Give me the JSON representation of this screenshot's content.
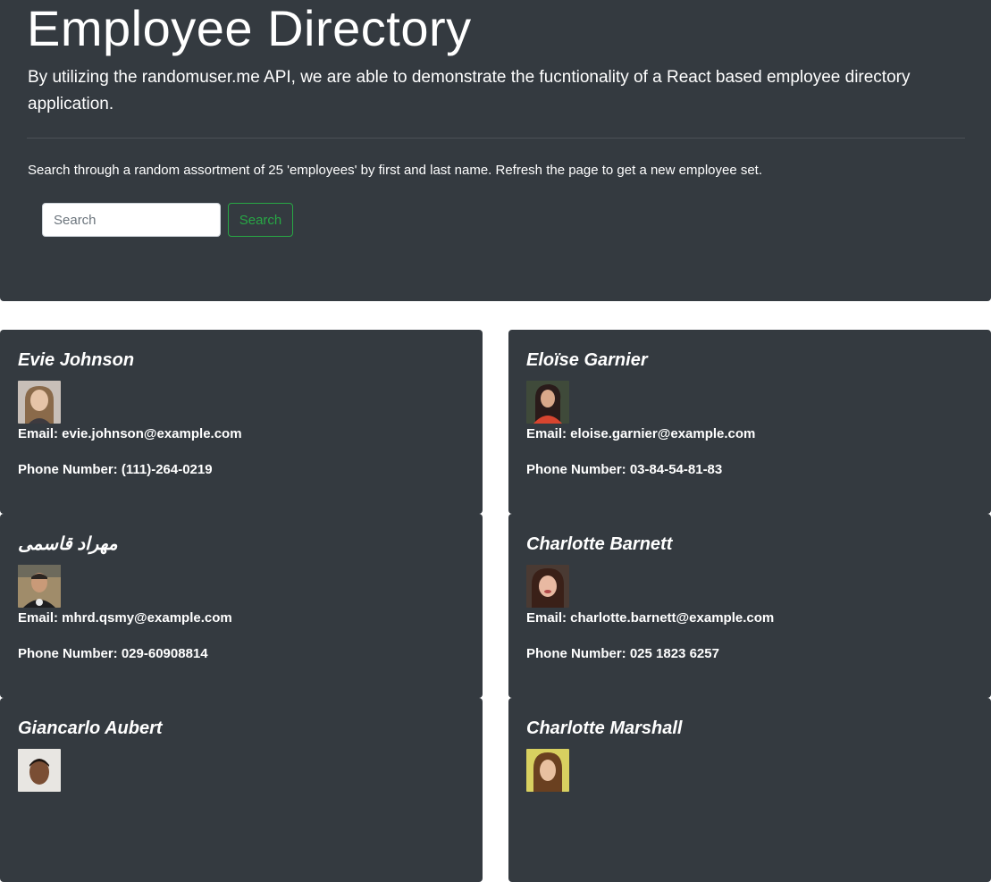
{
  "header": {
    "title": "Employee Directory",
    "lead": "By utilizing the randomuser.me API, we are able to demonstrate the fucntionality of a React based employee directory application.",
    "instructions": "Search through a random assortment of 25 'employees' by first and last name. Refresh the page to get a new employee set."
  },
  "search": {
    "placeholder": "Search",
    "value": "",
    "button_label": "Search"
  },
  "colors": {
    "panel_bg": "#343a40",
    "accent_green": "#28a745",
    "page_bg": "#ffffff"
  },
  "employees": [
    {
      "name": "Evie Johnson",
      "email": "Email: evie.johnson@example.com",
      "phone": "Phone Number: (111)-264-0219"
    },
    {
      "name": "Eloïse Garnier",
      "email": "Email: eloise.garnier@example.com",
      "phone": "Phone Number: 03-84-54-81-83"
    },
    {
      "name": "مهراد قاسمی",
      "email": "Email: mhrd.qsmy@example.com",
      "phone": "Phone Number: 029-60908814"
    },
    {
      "name": "Charlotte Barnett",
      "email": "Email: charlotte.barnett@example.com",
      "phone": "Phone Number: 025 1823 6257"
    },
    {
      "name": "Giancarlo Aubert",
      "email": "",
      "phone": ""
    },
    {
      "name": "Charlotte Marshall",
      "email": "",
      "phone": ""
    }
  ]
}
